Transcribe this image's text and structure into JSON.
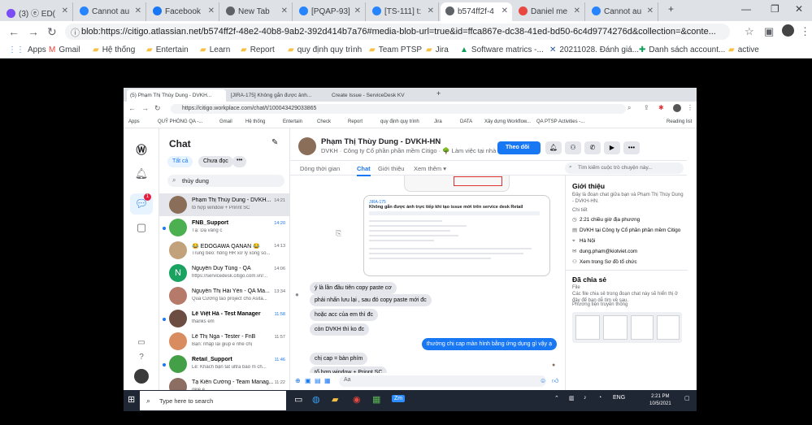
{
  "outer": {
    "tabs": [
      {
        "label": "(3) ⓔ ED(",
        "color": "#7b4cf5"
      },
      {
        "label": "Cannot au",
        "color": "#2684ff"
      },
      {
        "label": "Facebook",
        "color": "#1877f2"
      },
      {
        "label": "New Tab",
        "color": "#5f6368"
      },
      {
        "label": "[PQAP-93]",
        "color": "#2684ff"
      },
      {
        "label": "[TS-111] t:",
        "color": "#2684ff"
      },
      {
        "label": "b574ff2f-4",
        "color": "#5f6368"
      },
      {
        "label": "Daniel me",
        "color": "#e8483f"
      },
      {
        "label": "Cannot au",
        "color": "#2684ff"
      }
    ],
    "url": "blob:https://citigo.atlassian.net/b574ff2f-48e2-40b8-9ab2-392d414b7a76#media-blob-url=true&id=ffca867e-dc38-41ed-bd50-6c4d9774276d&collection=&conte...",
    "bookmarks": [
      "Apps",
      "Gmail",
      "Hệ thống",
      "Entertain",
      "Learn",
      "Report",
      "quy định quy trình",
      "Team PTSP",
      "Jira",
      "Software matrics -...",
      "20211028. Đánh giá...",
      "Danh sách account...",
      "active"
    ]
  },
  "inner": {
    "tabs": [
      "(5) Phạm Thị Thùy Dung - DVKH...",
      "[JIRA-175] Không gắn được ảnh...",
      "Create Issue - ServiceDesk KV"
    ],
    "url": "https://citigo.workplace.com/chat/t/100043429033865",
    "bookmarks": [
      "Apps",
      "QUỸ PHÒNG QA -...",
      "Gmail",
      "Hệ thống",
      "Entertain",
      "Check",
      "Report",
      "quy định quy trình",
      "Jira",
      "DATA",
      "Xây dựng Workflow...",
      "QA PTSP Activities -...",
      "Reading list"
    ],
    "rail_badge": "1"
  },
  "chat": {
    "title": "Chat",
    "filter_all": "Tất cả",
    "filter_unread": "Chưa đọc",
    "search_value": "thùy dung",
    "items": [
      {
        "name": "Phạm Thị Thùy Dung - DVKH...",
        "preview": "tổ hợp window + Prinnt SC",
        "time": "14:21",
        "bold": false,
        "color": "#8a6e5a"
      },
      {
        "name": "FNB_Support",
        "preview": "Tạ: Dạ vâng c",
        "time": "14:20",
        "bold": true,
        "color": "#4caf50"
      },
      {
        "name": "😂 EDOGAWA QANAN 😂",
        "preview": "Trung béo: hông HR xử lý xong số...",
        "time": "14:13",
        "bold": false,
        "color": "#c2a27a"
      },
      {
        "name": "Nguyễn Duy Tùng - QA",
        "preview": "https://servicedesk.citigo.com.vn/...",
        "time": "14:06",
        "bold": false,
        "color": "#1aa260",
        "initial": "N"
      },
      {
        "name": "Nguyễn Thị Hải Yến - QA Ma...",
        "preview": "Qua Cương tao project cho Asita...",
        "time": "13:34",
        "bold": false,
        "color": "#b57a6a"
      },
      {
        "name": "Lê Việt Hà - Test Manager",
        "preview": "thanks em",
        "time": "11:58",
        "bold": true,
        "color": "#6d4c41"
      },
      {
        "name": "Lê Thị Nga - Tester - FnB",
        "preview": "Bạn: nhập lại giúp e nhé chị",
        "time": "11:57",
        "bold": false,
        "color": "#d98c5f"
      },
      {
        "name": "Retail_Support",
        "preview": "Lê: Khách bận tắt ultra báo m ch...",
        "time": "11:46",
        "bold": true,
        "color": "#43a047"
      },
      {
        "name": "Tạ Kiên Cường - Team Manag...",
        "preview": "okie e",
        "time": "11:22",
        "bold": false,
        "color": "#8d6e63"
      }
    ]
  },
  "conversation": {
    "name": "Phạm Thị Thùy Dung - DVKH-HN",
    "subtitle": "DVKH · Công ty Cổ phần phần mềm Citigo · 🌳 Làm việc tại nhà",
    "follow": "Theo dõi",
    "tabs": [
      "Dòng thời gian",
      "Chat",
      "Giới thiệu",
      "Xem thêm ▾"
    ],
    "search_placeholder": "Tìm kiếm cuộc trò chuyện này...",
    "shot_title": "Không gắn được ảnh trực tiếp khi tạo issue mới trên service desk Retail",
    "messages": [
      {
        "text": "ý là lần đầu tiên copy paste cơ",
        "dir": "in"
      },
      {
        "text": "phải nhấn lưu lại , sau đó copy paste mới đc",
        "dir": "in"
      },
      {
        "text": "hoặc acc của em thì đc",
        "dir": "in"
      },
      {
        "text": "còn DVKH thì ko đc",
        "dir": "in"
      },
      {
        "text": "thường chị cap màn hình bằng ứng dụng gì vậy ạ",
        "dir": "out"
      },
      {
        "text": "chị cap = bàn phím",
        "dir": "in"
      },
      {
        "text": "tổ hợp window + Prinnt SC",
        "dir": "in"
      }
    ],
    "compose_placeholder": "Aa"
  },
  "about": {
    "title": "Giới thiệu",
    "desc1": "Đây là đoạn chat giữa bạn và Phạm Thị Thùy Dung",
    "desc2": "- DVKH-HN.",
    "detail_label": "Chi tiết",
    "time": "2:21 chiều giờ địa phương",
    "company": "DVKH tại Công ty Cổ phần phần mềm Citigo",
    "location": "Hà Nội",
    "email": "dung.pham@kiotviet.com",
    "org": "Xem trong Sơ đồ tổ chức",
    "shared_title": "Đã chia sẻ",
    "files_label": "File",
    "files_desc1": "Các file chia sẻ trong đoạn chat này sẽ hiển thị ở",
    "files_desc2": "đây để bạn dễ tìm về sau.",
    "media_label": "Phương tiện truyền thông"
  },
  "taskbar": {
    "search_placeholder": "Type here to search",
    "lang": "ENG",
    "time": "2:21 PM",
    "date": "10/5/2021"
  }
}
